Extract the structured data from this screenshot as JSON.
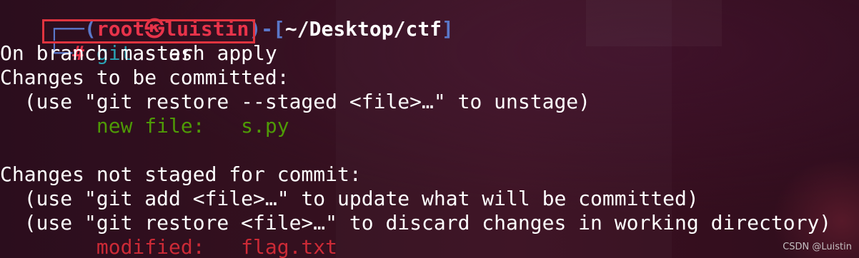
{
  "prompt": {
    "frame_top_prefix": "┌──(",
    "user_host": "root㉿luistin",
    "frame_mid": ")-[",
    "path": "~/Desktop/ctf",
    "frame_end": "]",
    "frame_bottom": "└─",
    "hash": "#",
    "command_git": "git",
    "command_rest": " stash apply"
  },
  "output": {
    "line_branch": "On branch master",
    "line_to_commit": "Changes to be committed:",
    "line_unstage_hint": "  (use \"git restore --staged <file>…\" to unstage)",
    "new_file_indent": "        ",
    "new_file_text": "new file:   s.py",
    "line_not_staged": "Changes not staged for commit:",
    "line_add_hint": "  (use \"git add <file>…\" to update what will be committed)",
    "line_discard_hint": "  (use \"git restore <file>…\" to discard changes in working directory)",
    "modified_indent": "        ",
    "modified_text": "modified:   flag.txt"
  },
  "watermark": "CSDN @Luistin"
}
